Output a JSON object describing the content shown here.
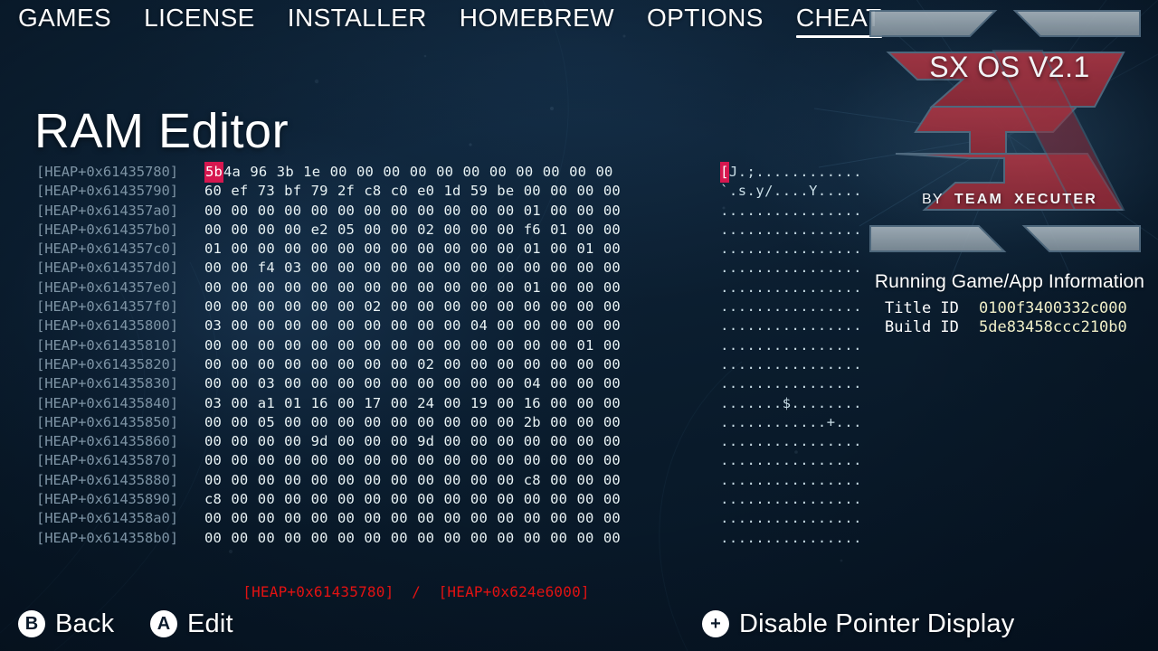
{
  "nav": {
    "items": [
      {
        "label": "GAMES",
        "active": false
      },
      {
        "label": "LICENSE",
        "active": false
      },
      {
        "label": "INSTALLER",
        "active": false
      },
      {
        "label": "HOMEBREW",
        "active": false
      },
      {
        "label": "OPTIONS",
        "active": false
      },
      {
        "label": "CHEAT",
        "active": true
      }
    ]
  },
  "page": {
    "title": "RAM Editor"
  },
  "hex_editor": {
    "selected_index": 0,
    "rows": [
      {
        "address": "[HEAP+0x61435780]",
        "bytes": [
          "5b",
          "4a",
          "96",
          "3b",
          "1e",
          "00",
          "00",
          "00",
          "00",
          "00",
          "00",
          "00",
          "00",
          "00",
          "00",
          "00"
        ],
        "ascii": "[J.;............"
      },
      {
        "address": "[HEAP+0x61435790]",
        "bytes": [
          "60",
          "ef",
          "73",
          "bf",
          "79",
          "2f",
          "c8",
          "c0",
          "e0",
          "1d",
          "59",
          "be",
          "00",
          "00",
          "00",
          "00"
        ],
        "ascii": "`.s.y/....Y....."
      },
      {
        "address": "[HEAP+0x614357a0]",
        "bytes": [
          "00",
          "00",
          "00",
          "00",
          "00",
          "00",
          "00",
          "00",
          "00",
          "00",
          "00",
          "00",
          "01",
          "00",
          "00",
          "00"
        ],
        "ascii": "................"
      },
      {
        "address": "[HEAP+0x614357b0]",
        "bytes": [
          "00",
          "00",
          "00",
          "00",
          "e2",
          "05",
          "00",
          "00",
          "02",
          "00",
          "00",
          "00",
          "f6",
          "01",
          "00",
          "00"
        ],
        "ascii": "................"
      },
      {
        "address": "[HEAP+0x614357c0]",
        "bytes": [
          "01",
          "00",
          "00",
          "00",
          "00",
          "00",
          "00",
          "00",
          "00",
          "00",
          "00",
          "00",
          "01",
          "00",
          "01",
          "00"
        ],
        "ascii": "................"
      },
      {
        "address": "[HEAP+0x614357d0]",
        "bytes": [
          "00",
          "00",
          "f4",
          "03",
          "00",
          "00",
          "00",
          "00",
          "00",
          "00",
          "00",
          "00",
          "00",
          "00",
          "00",
          "00"
        ],
        "ascii": "................"
      },
      {
        "address": "[HEAP+0x614357e0]",
        "bytes": [
          "00",
          "00",
          "00",
          "00",
          "00",
          "00",
          "00",
          "00",
          "00",
          "00",
          "00",
          "00",
          "01",
          "00",
          "00",
          "00"
        ],
        "ascii": "................"
      },
      {
        "address": "[HEAP+0x614357f0]",
        "bytes": [
          "00",
          "00",
          "00",
          "00",
          "00",
          "00",
          "02",
          "00",
          "00",
          "00",
          "00",
          "00",
          "00",
          "00",
          "00",
          "00"
        ],
        "ascii": "................"
      },
      {
        "address": "[HEAP+0x61435800]",
        "bytes": [
          "03",
          "00",
          "00",
          "00",
          "00",
          "00",
          "00",
          "00",
          "00",
          "00",
          "04",
          "00",
          "00",
          "00",
          "00",
          "00"
        ],
        "ascii": "................"
      },
      {
        "address": "[HEAP+0x61435810]",
        "bytes": [
          "00",
          "00",
          "00",
          "00",
          "00",
          "00",
          "00",
          "00",
          "00",
          "00",
          "00",
          "00",
          "00",
          "00",
          "01",
          "00"
        ],
        "ascii": "................"
      },
      {
        "address": "[HEAP+0x61435820]",
        "bytes": [
          "00",
          "00",
          "00",
          "00",
          "00",
          "00",
          "00",
          "00",
          "02",
          "00",
          "00",
          "00",
          "00",
          "00",
          "00",
          "00"
        ],
        "ascii": "................"
      },
      {
        "address": "[HEAP+0x61435830]",
        "bytes": [
          "00",
          "00",
          "03",
          "00",
          "00",
          "00",
          "00",
          "00",
          "00",
          "00",
          "00",
          "00",
          "04",
          "00",
          "00",
          "00"
        ],
        "ascii": "................"
      },
      {
        "address": "[HEAP+0x61435840]",
        "bytes": [
          "03",
          "00",
          "a1",
          "01",
          "16",
          "00",
          "17",
          "00",
          "24",
          "00",
          "19",
          "00",
          "16",
          "00",
          "00",
          "00"
        ],
        "ascii": ".......$........"
      },
      {
        "address": "[HEAP+0x61435850]",
        "bytes": [
          "00",
          "00",
          "05",
          "00",
          "00",
          "00",
          "00",
          "00",
          "00",
          "00",
          "00",
          "00",
          "2b",
          "00",
          "00",
          "00"
        ],
        "ascii": "............+..."
      },
      {
        "address": "[HEAP+0x61435860]",
        "bytes": [
          "00",
          "00",
          "00",
          "00",
          "9d",
          "00",
          "00",
          "00",
          "9d",
          "00",
          "00",
          "00",
          "00",
          "00",
          "00",
          "00"
        ],
        "ascii": "................"
      },
      {
        "address": "[HEAP+0x61435870]",
        "bytes": [
          "00",
          "00",
          "00",
          "00",
          "00",
          "00",
          "00",
          "00",
          "00",
          "00",
          "00",
          "00",
          "00",
          "00",
          "00",
          "00"
        ],
        "ascii": "................"
      },
      {
        "address": "[HEAP+0x61435880]",
        "bytes": [
          "00",
          "00",
          "00",
          "00",
          "00",
          "00",
          "00",
          "00",
          "00",
          "00",
          "00",
          "00",
          "c8",
          "00",
          "00",
          "00"
        ],
        "ascii": "................"
      },
      {
        "address": "[HEAP+0x61435890]",
        "bytes": [
          "c8",
          "00",
          "00",
          "00",
          "00",
          "00",
          "00",
          "00",
          "00",
          "00",
          "00",
          "00",
          "00",
          "00",
          "00",
          "00"
        ],
        "ascii": "................"
      },
      {
        "address": "[HEAP+0x614358a0]",
        "bytes": [
          "00",
          "00",
          "00",
          "00",
          "00",
          "00",
          "00",
          "00",
          "00",
          "00",
          "00",
          "00",
          "00",
          "00",
          "00",
          "00"
        ],
        "ascii": "................"
      },
      {
        "address": "[HEAP+0x614358b0]",
        "bytes": [
          "00",
          "00",
          "00",
          "00",
          "00",
          "00",
          "00",
          "00",
          "00",
          "00",
          "00",
          "00",
          "00",
          "00",
          "00",
          "00"
        ],
        "ascii": "................"
      }
    ]
  },
  "status": {
    "current_address": "[HEAP+0x61435780]",
    "separator": "/",
    "total_address": "[HEAP+0x624e6000]",
    "text": "[HEAP+0x61435780]  /  [HEAP+0x624e6000]",
    "color": "#e21212"
  },
  "bottom_hints": [
    {
      "glyph": "B",
      "label": "Back"
    },
    {
      "glyph": "A",
      "label": "Edit"
    },
    {
      "glyph": "+",
      "label": "Disable Pointer Display"
    }
  ],
  "logo": {
    "title": "SX OS V2.1",
    "by_word": "BY",
    "team_word": "TEAM",
    "brand_word": "XECUTER",
    "red": "#9e3040",
    "grey": "#93a2ac"
  },
  "info": {
    "heading": "Running Game/App Information",
    "rows": [
      {
        "key": "Title ID",
        "value": "0100f3400332c000"
      },
      {
        "key": "Build ID",
        "value": "5de83458ccc210b0"
      }
    ],
    "value_color": "#f0efc8"
  }
}
